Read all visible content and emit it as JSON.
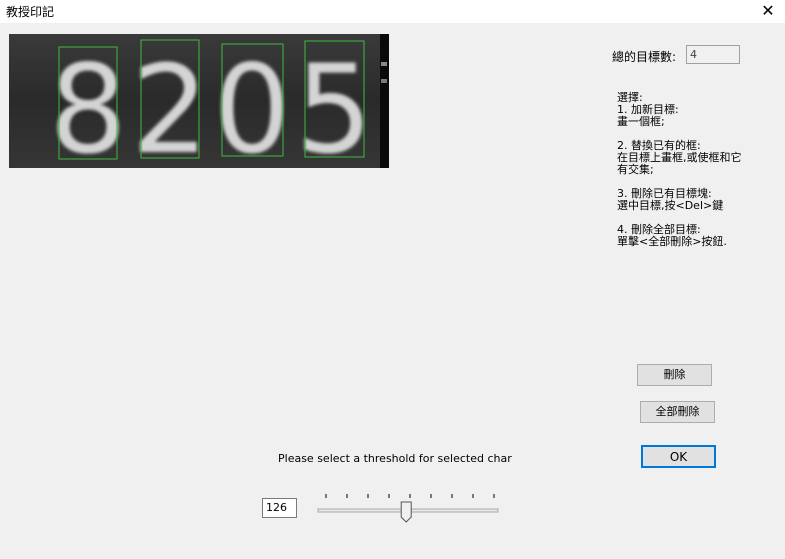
{
  "window": {
    "title": "教授印記",
    "close_glyph": "✕"
  },
  "image": {
    "digits": [
      "8",
      "2",
      "0",
      "5"
    ]
  },
  "count": {
    "label": "總的目標數:",
    "value": "4"
  },
  "help_text": "選擇:\n1. 加新目標:\n畫一個框;\n\n2. 替換已有的框:\n在目標上畫框,或使框和它\n有交集;\n\n3. 刪除已有目標塊:\n選中目標,按<Del>鍵\n\n4. 刪除全部目標:\n單擊<全部刪除>按鈕.",
  "buttons": {
    "delete": "刪除",
    "delete_all": "全部刪除",
    "ok": "OK"
  },
  "threshold": {
    "prompt": "Please select a threshold for selected char",
    "value": "126",
    "slider_fraction": 0.49
  }
}
